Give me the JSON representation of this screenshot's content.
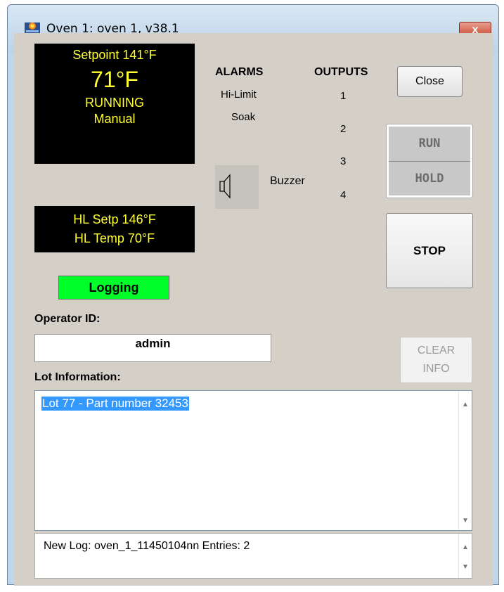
{
  "window": {
    "title": "Oven 1: oven 1, v38.1",
    "close_glyph": "x"
  },
  "display": {
    "setpoint": "Setpoint 141°F",
    "temperature": "71°F",
    "status": "RUNNING",
    "mode": "Manual",
    "hl_setpoint": "HL Setp 146°F",
    "hl_temp": "HL Temp 70°F",
    "text_color": "#ffff33",
    "background": "#000000"
  },
  "alarms": {
    "header": "ALARMS",
    "items": [
      "Hi-Limit",
      "Soak"
    ]
  },
  "outputs": {
    "header": "OUTPUTS",
    "items": [
      "1",
      "2",
      "3",
      "4"
    ]
  },
  "buzzer": {
    "label": "Buzzer",
    "icon": "speaker-icon"
  },
  "buttons": {
    "close": "Close",
    "run": "RUN",
    "hold": "HOLD",
    "stop": "STOP",
    "clear_line1": "CLEAR",
    "clear_line2": "INFO"
  },
  "logging": {
    "label": "Logging",
    "color": "#00ff2a"
  },
  "operator": {
    "label": "Operator ID:",
    "value": "admin"
  },
  "lot": {
    "label": "Lot Information:",
    "value": "Lot 77 - Part number 32453"
  },
  "log_status": "New Log: oven_1_11450104nn Entries: 2"
}
